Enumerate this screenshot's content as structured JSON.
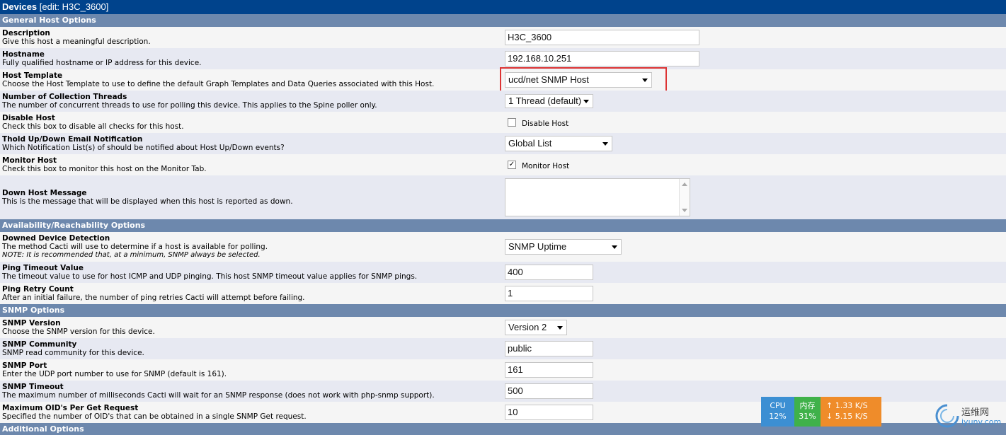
{
  "title": {
    "main": "Devices",
    "sub": "[edit: H3C_3600]"
  },
  "sections": {
    "general": "General Host Options",
    "availability": "Availability/Reachability Options",
    "snmp": "SNMP Options",
    "additional": "Additional Options"
  },
  "fields": {
    "description": {
      "label": "Description",
      "desc": "Give this host a meaningful description.",
      "value": "H3C_3600"
    },
    "hostname": {
      "label": "Hostname",
      "desc": "Fully qualified hostname or IP address for this device.",
      "value": "192.168.10.251"
    },
    "host_template": {
      "label": "Host Template",
      "desc": "Choose the Host Template to use to define the default Graph Templates and Data Queries associated with this Host.",
      "value": "ucd/net SNMP Host"
    },
    "threads": {
      "label": "Number of Collection Threads",
      "desc": "The number of concurrent threads to use for polling this device. This applies to the Spine poller only.",
      "value": "1 Thread (default)"
    },
    "disable_host": {
      "label": "Disable Host",
      "desc": "Check this box to disable all checks for this host.",
      "checkbox_label": "Disable Host",
      "checked": false
    },
    "thold": {
      "label": "Thold Up/Down Email Notification",
      "desc": "Which Notification List(s) of should be notified about Host Up/Down events?",
      "value": "Global List"
    },
    "monitor_host": {
      "label": "Monitor Host",
      "desc": "Check this box to monitor this host on the Monitor Tab.",
      "checkbox_label": "Monitor Host",
      "checked": true,
      "check_glyph": "✓"
    },
    "down_msg": {
      "label": "Down Host Message",
      "desc": "This is the message that will be displayed when this host is reported as down.",
      "value": ""
    },
    "downed_detection": {
      "label": "Downed Device Detection",
      "desc": "The method Cacti will use to determine if a host is available for polling.",
      "note": "NOTE: It is recommended that, at a minimum, SNMP always be selected.",
      "value": "SNMP Uptime"
    },
    "ping_timeout": {
      "label": "Ping Timeout Value",
      "desc": "The timeout value to use for host ICMP and UDP pinging. This host SNMP timeout value applies for SNMP pings.",
      "value": "400"
    },
    "ping_retry": {
      "label": "Ping Retry Count",
      "desc": "After an initial failure, the number of ping retries Cacti will attempt before failing.",
      "value": "1"
    },
    "snmp_version": {
      "label": "SNMP Version",
      "desc": "Choose the SNMP version for this device.",
      "value": "Version 2"
    },
    "snmp_community": {
      "label": "SNMP Community",
      "desc": "SNMP read community for this device.",
      "value": "public"
    },
    "snmp_port": {
      "label": "SNMP Port",
      "desc": "Enter the UDP port number to use for SNMP (default is 161).",
      "value": "161"
    },
    "snmp_timeout": {
      "label": "SNMP Timeout",
      "desc": "The maximum number of milliseconds Cacti will wait for an SNMP response (does not work with php-snmp support).",
      "value": "500"
    },
    "max_oid": {
      "label": "Maximum OID's Per Get Request",
      "desc": "Specified the number of OID's that can be obtained in a single SNMP Get request.",
      "value": "10"
    }
  },
  "widget": {
    "cpu_label": "CPU",
    "cpu_value": "12%",
    "mem_label": "内存",
    "mem_value": "31%",
    "up_arrow": "↑",
    "up_speed": "1.33 K/S",
    "down_arrow": "↓",
    "down_speed": "5.15 K/S",
    "logo_text": "运维网",
    "logo_url": "iyunv.com"
  },
  "colors": {
    "titlebar": "#00438c",
    "section": "#6d88ad",
    "highlight": "#d33333"
  }
}
